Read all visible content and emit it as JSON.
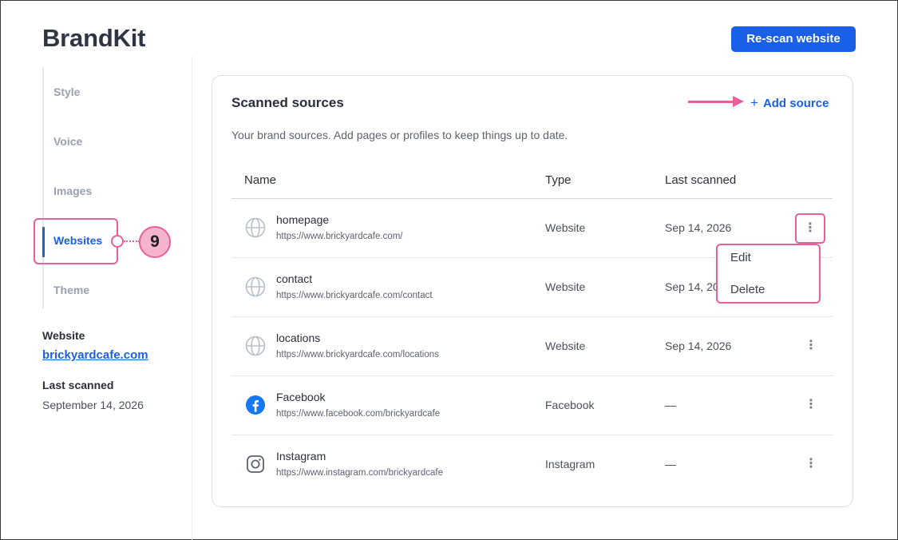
{
  "app": {
    "title": "BrandKit"
  },
  "header": {
    "rescan_label": "Re-scan website"
  },
  "sidebar": {
    "items": [
      {
        "label": "Style",
        "active": false
      },
      {
        "label": "Voice",
        "active": false
      },
      {
        "label": "Images",
        "active": false
      },
      {
        "label": "Websites",
        "active": true
      },
      {
        "label": "Theme",
        "active": false
      }
    ],
    "callout_number": "9",
    "website_label": "Website",
    "website_value": "brickyardcafe.com",
    "last_scanned_label": "Last scanned",
    "last_scanned_value": "September 14, 2026"
  },
  "main": {
    "title": "Scanned sources",
    "add_source_label": "Add source",
    "description": "Your brand sources. Add pages or profiles to keep things up to date.",
    "columns": [
      "Name",
      "Type",
      "Last scanned"
    ],
    "rows": [
      {
        "icon": "globe-icon",
        "name": "homepage",
        "url": "https://www.brickyardcafe.com/",
        "type": "Website",
        "last_scanned": "Sep 14, 2026"
      },
      {
        "icon": "globe-icon",
        "name": "contact",
        "url": "https://www.brickyardcafe.com/contact",
        "type": "Website",
        "last_scanned": "Sep 14, 2026"
      },
      {
        "icon": "globe-icon",
        "name": "locations",
        "url": "https://www.brickyardcafe.com/locations",
        "type": "Website",
        "last_scanned": "Sep 14, 2026"
      },
      {
        "icon": "facebook-icon",
        "name": "Facebook",
        "url": "https://www.facebook.com/brickyardcafe",
        "type": "Facebook",
        "last_scanned": "—"
      },
      {
        "icon": "instagram-icon",
        "name": "Instagram",
        "url": "https://www.instagram.com/brickyardcafe",
        "type": "Instagram",
        "last_scanned": "—"
      }
    ],
    "row_menu": {
      "items": [
        "Edit",
        "Delete"
      ]
    }
  },
  "colors": {
    "accent": "#1a5fe8",
    "highlight": "#e8609a",
    "callout_fill": "#f5b3ce",
    "facebook": "#1877f2"
  }
}
